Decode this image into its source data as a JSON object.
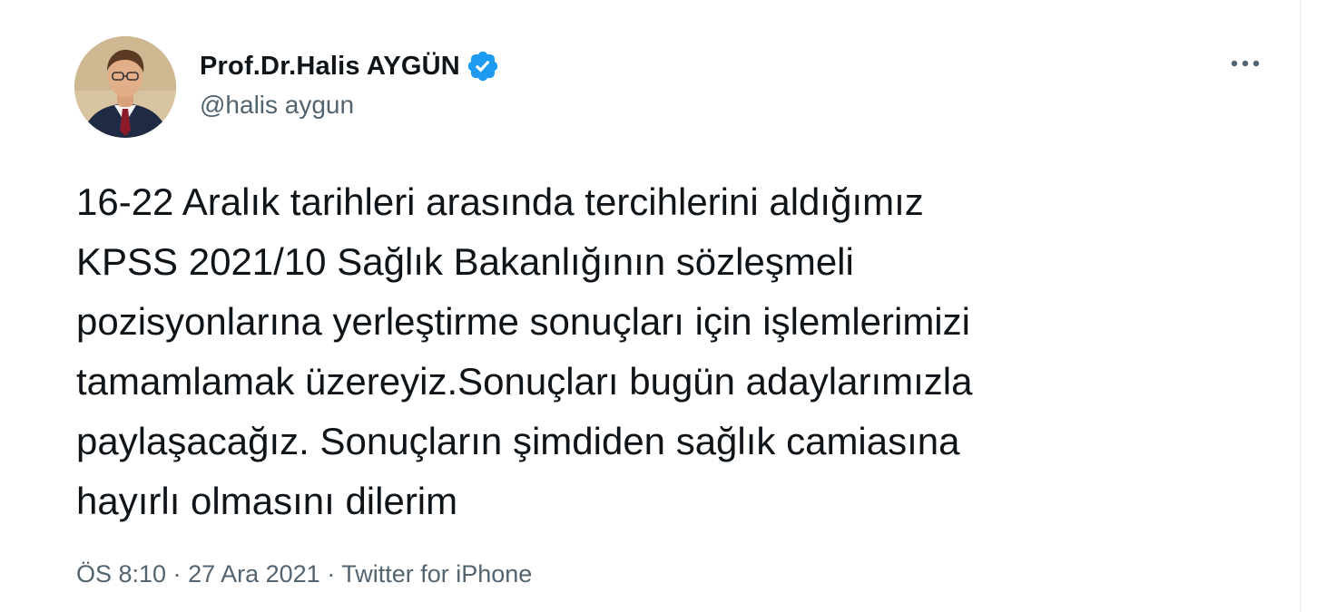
{
  "tweet": {
    "author": {
      "display_name": "Prof.Dr.Halis AYGÜN",
      "handle": "@halis aygun",
      "verified": true,
      "avatar": "avatar-photo"
    },
    "more_icon": "more-horizontal-icon",
    "text_lines": [
      "16-22 Aralık tarihleri arasında tercihlerini aldığımız",
      "KPSS 2021/10 Sağlık Bakanlığının sözleşmeli",
      "pozisyonlarına yerleştirme sonuçları için işlemlerimizi",
      "tamamlamak üzereyiz.Sonuçları bugün adaylarımızla",
      "paylaşacağız. Sonuçların şimdiden sağlık camiasına",
      "hayırlı olmasını dilerim"
    ],
    "meta": {
      "time": "ÖS 8:10",
      "separator": " · ",
      "date": "27 Ara 2021",
      "source": "Twitter for iPhone"
    }
  },
  "colors": {
    "verified_blue": "#1d9bf0",
    "secondary_text": "#536471",
    "primary_text": "#0f1419"
  }
}
